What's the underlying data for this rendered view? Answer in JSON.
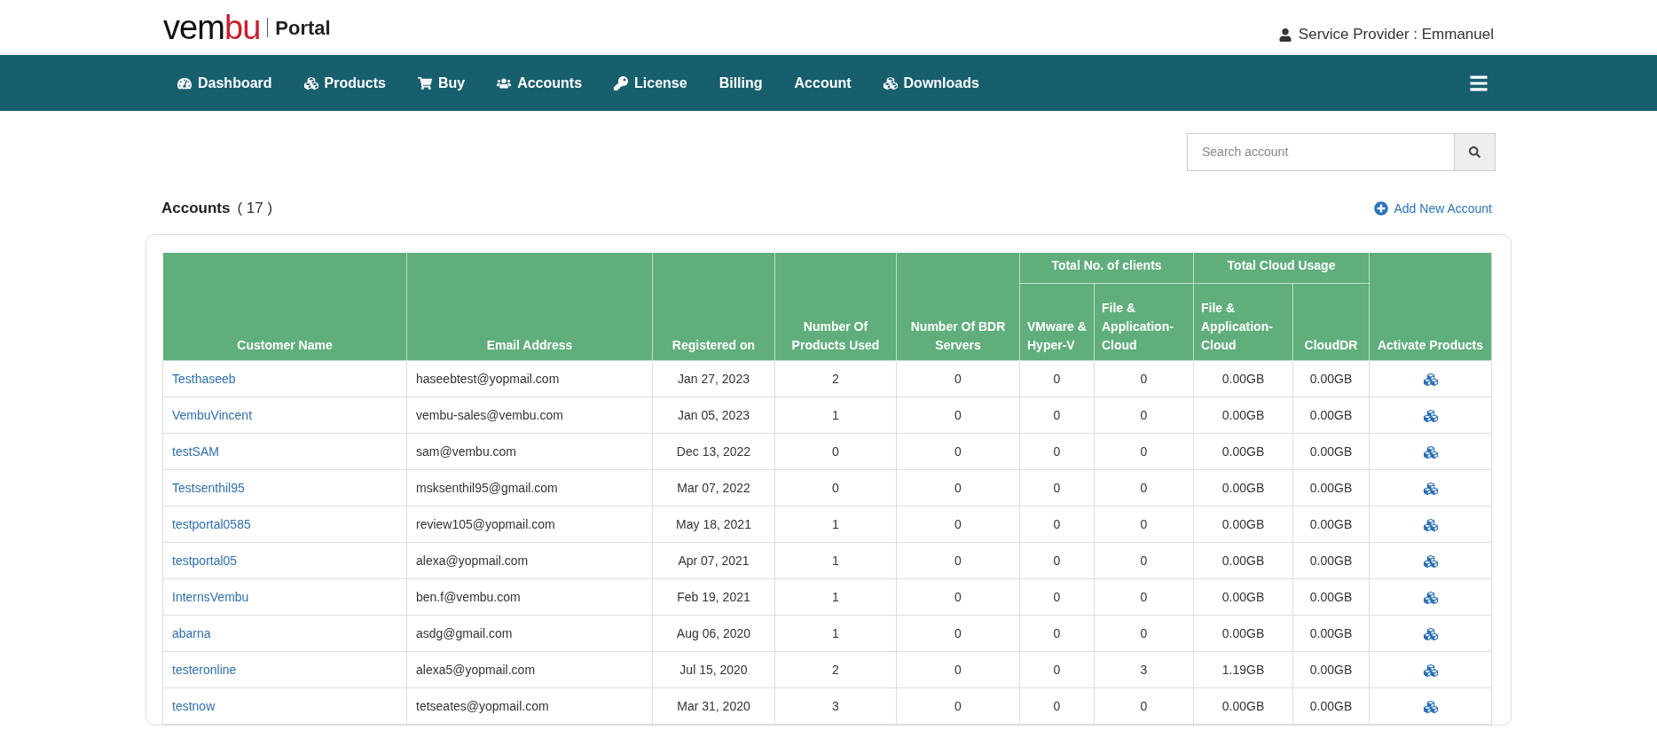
{
  "logo": {
    "brand_start": "vem",
    "brand_end": "bu",
    "product": "Portal"
  },
  "user": {
    "label": "Service Provider : Emmanuel"
  },
  "nav": [
    {
      "label": "Dashboard",
      "kind": "dashboard"
    },
    {
      "label": "Products",
      "kind": "cubes"
    },
    {
      "label": "Buy",
      "kind": "cart"
    },
    {
      "label": "Accounts",
      "kind": "users"
    },
    {
      "label": "License",
      "kind": "key"
    },
    {
      "label": "Billing",
      "kind": "text"
    },
    {
      "label": "Account",
      "kind": "text"
    },
    {
      "label": "Downloads",
      "kind": "cubes"
    }
  ],
  "search": {
    "placeholder": "Search account"
  },
  "accounts": {
    "title": "Accounts",
    "count": "( 17 )",
    "add_label": "Add New Account"
  },
  "table": {
    "groups": [
      "Total No. of clients",
      "Total Cloud Usage"
    ],
    "columns": [
      "Customer Name",
      "Email Address",
      "Registered on",
      "Number Of Products Used",
      "Number Of BDR Servers",
      "VMware & Hyper-V",
      "File & Application-Cloud",
      "File & Application-Cloud",
      "CloudDR",
      "Activate Products"
    ],
    "rows": [
      [
        "Testhaseeb",
        "haseebtest@yopmail.com",
        "Jan 27, 2023",
        "2",
        "0",
        "0",
        "0",
        "0.00GB",
        "0.00GB"
      ],
      [
        "VembuVincent",
        "vembu-sales@vembu.com",
        "Jan 05, 2023",
        "1",
        "0",
        "0",
        "0",
        "0.00GB",
        "0.00GB"
      ],
      [
        "testSAM",
        "sam@vembu.com",
        "Dec 13, 2022",
        "0",
        "0",
        "0",
        "0",
        "0.00GB",
        "0.00GB"
      ],
      [
        "Testsenthil95",
        "msksenthil95@gmail.com",
        "Mar 07, 2022",
        "0",
        "0",
        "0",
        "0",
        "0.00GB",
        "0.00GB"
      ],
      [
        "testportal0585",
        "review105@yopmail.com",
        "May 18, 2021",
        "1",
        "0",
        "0",
        "0",
        "0.00GB",
        "0.00GB"
      ],
      [
        "testportal05",
        "alexa@yopmail.com",
        "Apr 07, 2021",
        "1",
        "0",
        "0",
        "0",
        "0.00GB",
        "0.00GB"
      ],
      [
        "InternsVembu",
        "ben.f@vembu.com",
        "Feb 19, 2021",
        "1",
        "0",
        "0",
        "0",
        "0.00GB",
        "0.00GB"
      ],
      [
        "abarna",
        "asdg@gmail.com",
        "Aug 06, 2020",
        "1",
        "0",
        "0",
        "0",
        "0.00GB",
        "0.00GB"
      ],
      [
        "testeronline",
        "alexa5@yopmail.com",
        "Jul 15, 2020",
        "2",
        "0",
        "0",
        "3",
        "1.19GB",
        "0.00GB"
      ],
      [
        "testnow",
        "tetseates@yopmail.com",
        "Mar 31, 2020",
        "3",
        "0",
        "0",
        "0",
        "0.00GB",
        "0.00GB"
      ]
    ]
  }
}
